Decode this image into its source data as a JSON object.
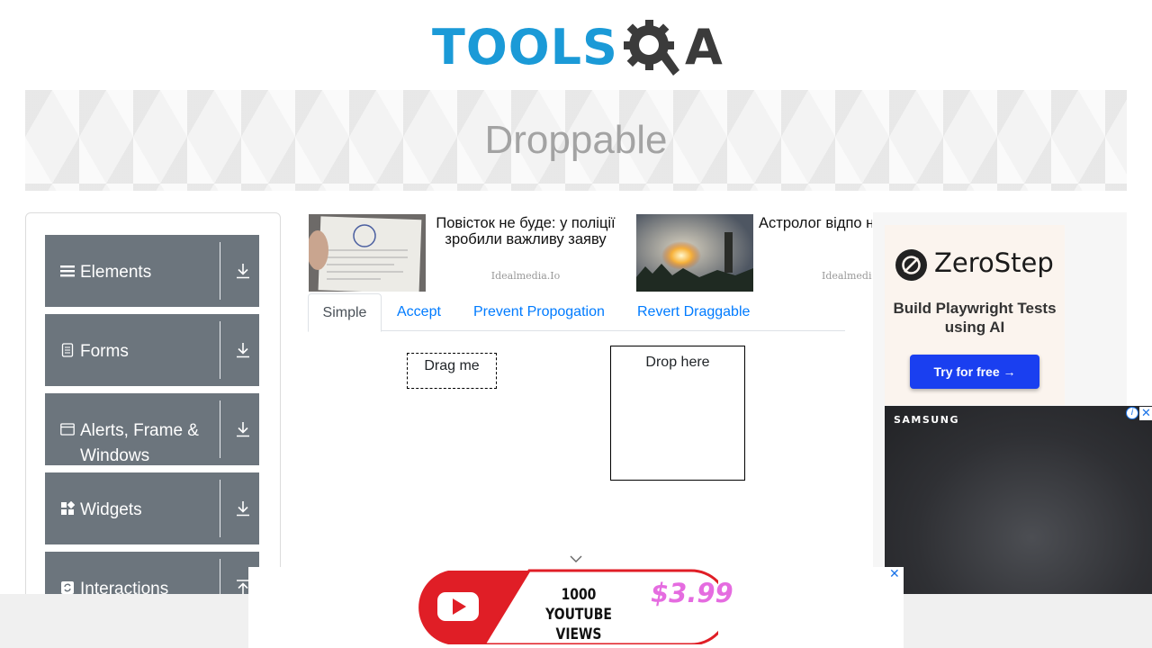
{
  "logo": {
    "text": "TOOLS",
    "suffix": "A",
    "text_color": "#1b9ad7",
    "gear_color": "#3b3b3b"
  },
  "banner": {
    "title": "Droppable"
  },
  "sidebar": {
    "groups": [
      {
        "label": "Elements",
        "icon": "hamburger-icon"
      },
      {
        "label": "Forms",
        "icon": "document-icon"
      },
      {
        "label": "Alerts, Frame & Windows",
        "icon": "window-icon"
      },
      {
        "label": "Widgets",
        "icon": "grid-icon"
      },
      {
        "label": "Interactions",
        "icon": "refresh-icon"
      }
    ],
    "group_bg": "#6c757d"
  },
  "ads": {
    "card1": {
      "title": "Повісток не буде: у поліції зробили важливу заяву",
      "source": "Idealmedia.Io"
    },
    "card2": {
      "title": "Астролог відпо незабаром пол ракети та д",
      "source": "Idealmedia"
    }
  },
  "tabs": [
    {
      "label": "Simple",
      "active": true
    },
    {
      "label": "Accept",
      "active": false
    },
    {
      "label": "Prevent Propogation",
      "active": false
    },
    {
      "label": "Revert Draggable",
      "active": false
    }
  ],
  "draggable": {
    "label": "Drag me"
  },
  "droppable": {
    "label": "Drop here"
  },
  "right_ad": {
    "brand": "ZeroStep",
    "tagline": "Build Playwright Tests using AI",
    "cta": "Try for free →",
    "cta_color": "#1a3ff0"
  },
  "video_ad": {
    "brand": "SAMSUNG"
  },
  "bottom_ad": {
    "line1": "1000",
    "line2": "YOUTUBE VIEWS",
    "price": "$3.99",
    "close": "✕"
  }
}
